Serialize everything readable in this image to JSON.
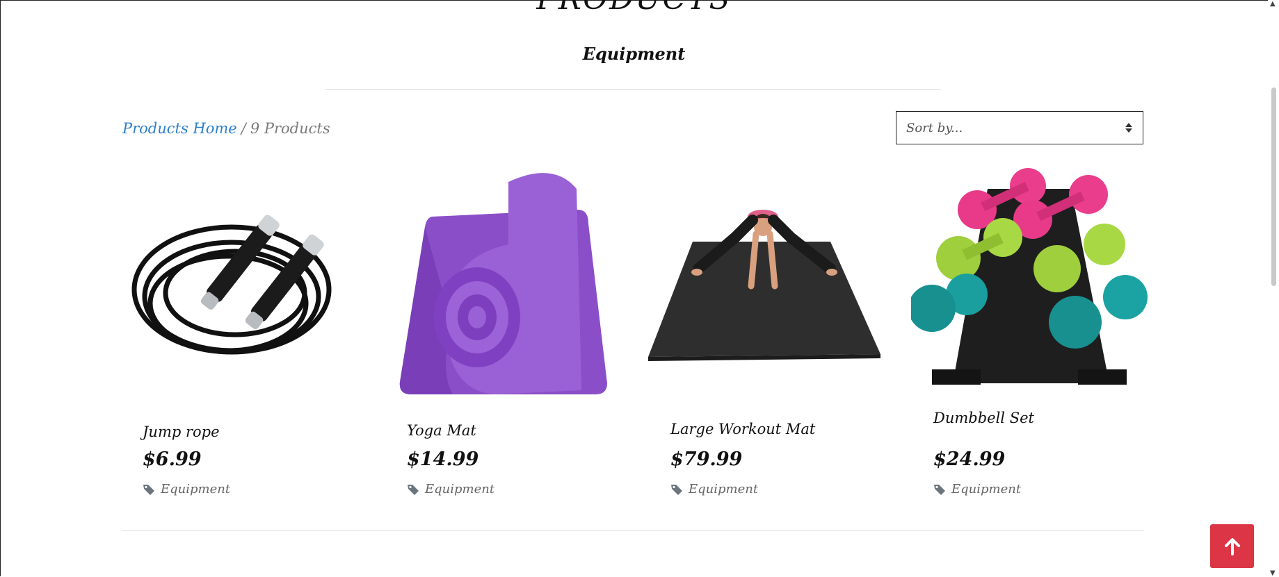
{
  "page": {
    "heading": "PRODUCTS",
    "category_title": "Equipment"
  },
  "breadcrumb": {
    "home_label": "Products Home",
    "separator": "/",
    "count_label": "9 Products"
  },
  "sort": {
    "selected": "Sort by..."
  },
  "products": [
    {
      "name": "Jump rope",
      "price": "$6.99",
      "category": "Equipment",
      "image": "jump-rope"
    },
    {
      "name": "Yoga Mat",
      "price": "$14.99",
      "category": "Equipment",
      "image": "yoga-mat"
    },
    {
      "name": "Large Workout Mat",
      "price": "$79.99",
      "category": "Equipment",
      "image": "large-workout-mat"
    },
    {
      "name": "Dumbbell Set",
      "price": "$24.99",
      "category": "Equipment",
      "image": "dumbbell-set"
    }
  ],
  "icons": {
    "tag": "tag-icon",
    "back_to_top": "arrow-up-icon",
    "sort_arrows": "sort-arrows-icon"
  },
  "colors": {
    "link": "#2c7fce",
    "back_to_top": "#dc3545",
    "tag_icon": "#6c757d"
  }
}
